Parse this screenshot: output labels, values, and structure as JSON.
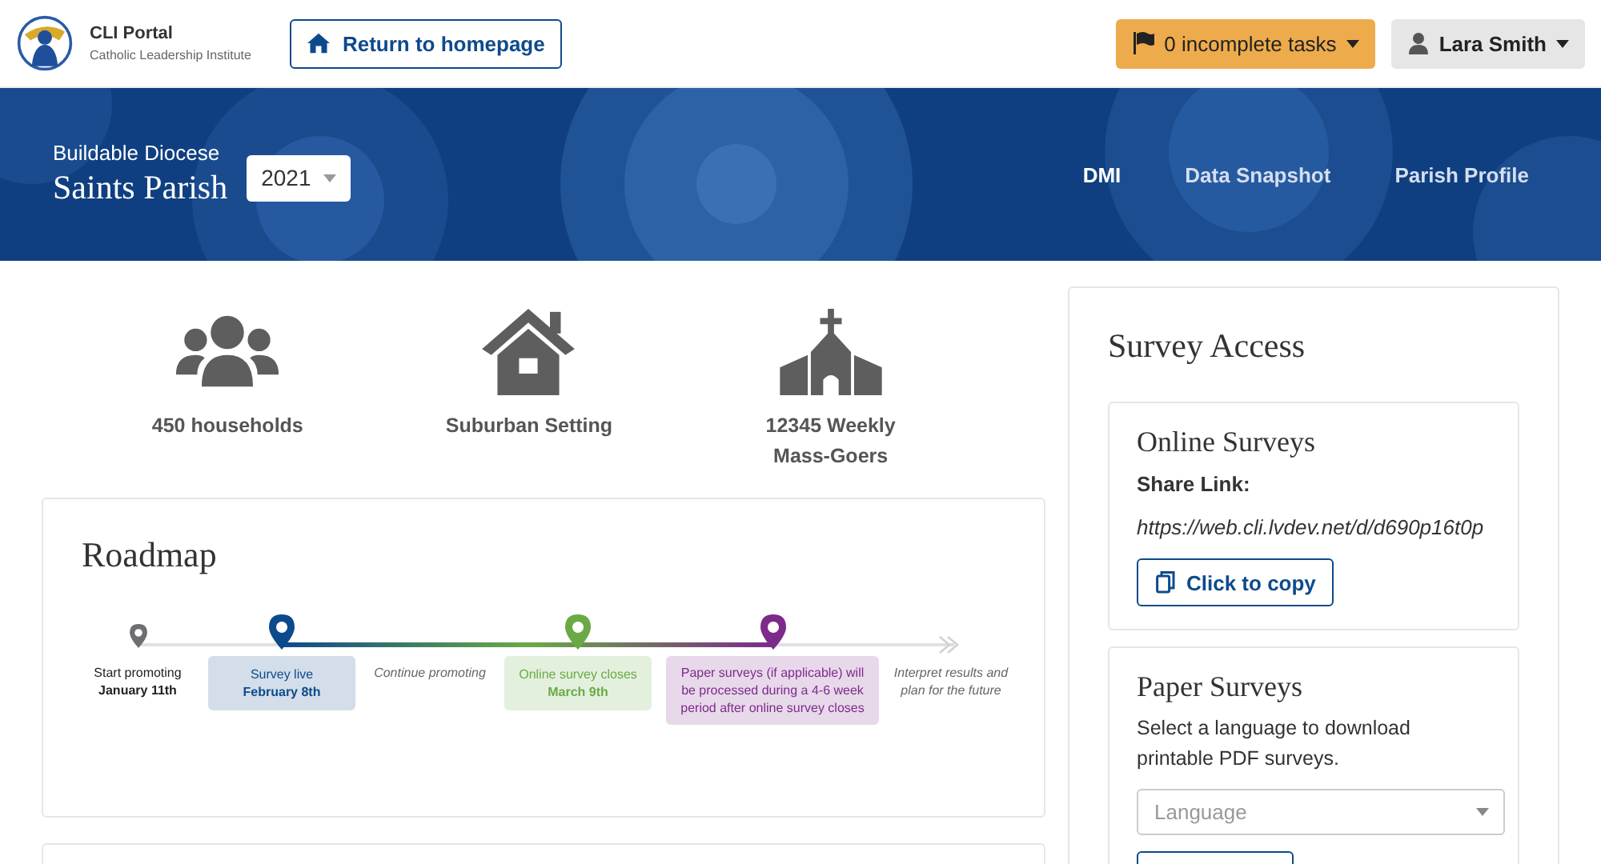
{
  "header": {
    "brand": {
      "title": "CLI Portal",
      "subtitle": "Catholic Leadership Institute"
    },
    "home_button": "Return to homepage",
    "tasks_button": "0 incomplete tasks",
    "user_button": "Lara Smith"
  },
  "banner": {
    "kind": "picture",
    "diocese": "Buildable Diocese",
    "parish": "Saints Parish",
    "year": "2021",
    "nav": [
      {
        "label": "DMI",
        "selected": true
      },
      {
        "label": "Data Snapshot",
        "selected": false
      },
      {
        "label": "Parish Profile",
        "selected": false
      }
    ]
  },
  "stats": [
    {
      "kind": "people",
      "label": "450 households"
    },
    {
      "kind": "house",
      "label": "Suburban Setting"
    },
    {
      "kind": "church",
      "label": "12345 Weekly Mass-Goers"
    }
  ],
  "roadmap": {
    "title": "Roadmap",
    "steps": [
      {
        "kind": "plain",
        "color": "#6d6e70",
        "label": "Start promoting",
        "date": "January 11th"
      },
      {
        "kind": "box",
        "color": "#0d4a8c",
        "label": "Survey live",
        "date": "February 8th"
      },
      {
        "kind": "note",
        "label": "Continue promoting"
      },
      {
        "kind": "box",
        "color": "#6aaa45",
        "label": "Online survey closes",
        "date": "March 9th"
      },
      {
        "kind": "box",
        "color": "#7d2b8b",
        "label": "Paper surveys (if applicable) will be processed during a 4-6 week period after online survey closes"
      },
      {
        "kind": "note",
        "label": "Interpret results and plan for the future"
      }
    ]
  },
  "survey_access": {
    "title": "Survey Access",
    "online": {
      "title": "Online Surveys",
      "share_label": "Share Link:",
      "link": "https://web.cli.lvdev.net/d/d690p16t0p",
      "copy_button": "Click to copy"
    },
    "paper": {
      "title": "Paper Surveys",
      "description": "Select a language to download printable PDF surveys.",
      "language": {
        "placeholder": "Language"
      }
    }
  }
}
